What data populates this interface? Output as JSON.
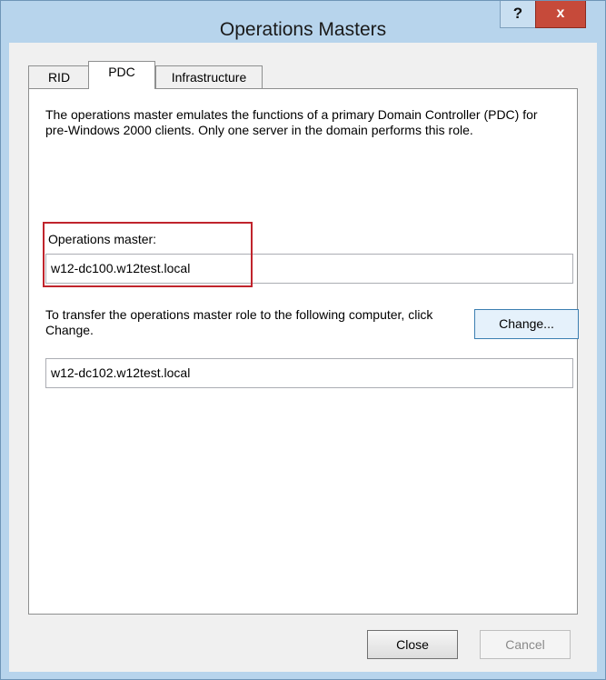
{
  "window": {
    "title": "Operations Masters",
    "help_glyph": "?",
    "close_glyph": "x"
  },
  "tabs": [
    {
      "label": "RID",
      "selected": false
    },
    {
      "label": "PDC",
      "selected": true
    },
    {
      "label": "Infrastructure",
      "selected": false
    }
  ],
  "pdc": {
    "description": "The operations master emulates the functions of a primary Domain Controller (PDC) for pre-Windows 2000 clients. Only one server in the domain performs this role.",
    "operations_master_label": "Operations master:",
    "operations_master_value": "w12-dc100.w12test.local",
    "transfer_text": "To transfer the operations master role to the following computer, click Change.",
    "change_button": "Change...",
    "target_value": "w12-dc102.w12test.local"
  },
  "footer": {
    "close_button": "Close",
    "cancel_button": "Cancel",
    "cancel_enabled": false
  },
  "colors": {
    "titlebar": "#b7d4ec",
    "close_button": "#c64a3a",
    "highlight_box": "#c0242c"
  }
}
